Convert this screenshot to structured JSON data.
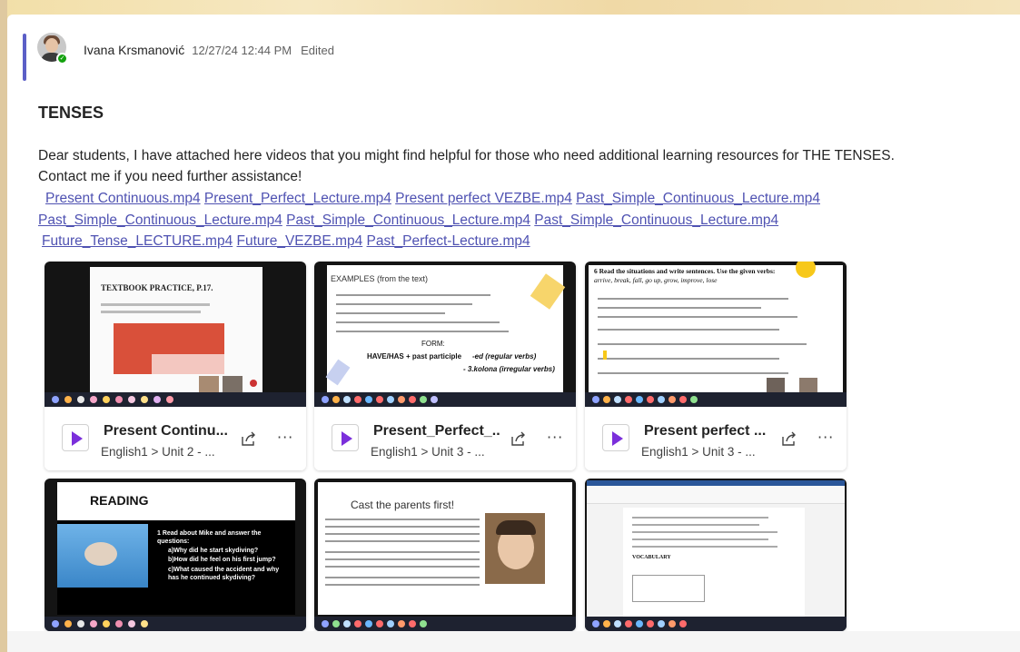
{
  "message": {
    "author": "Ivana Krsmanović",
    "timestamp": "12/27/24 12:44 PM",
    "edited_label": "Edited",
    "subject": "TENSES",
    "body_line1": "Dear students, I have attached here videos that you might find helpful for those who need additional learning resources for THE TENSES.",
    "body_line2": "Contact me if you need further assistance!",
    "links_row1": [
      "Present Continuous.mp4",
      "Present_Perfect_Lecture.mp4",
      "Present perfect VEZBE.mp4",
      "Past_Simple_Continuous_Lecture.mp4"
    ],
    "links_row2": [
      "Past_Simple_Continuous_Lecture.mp4",
      "Past_Simple_Continuous_Lecture.mp4",
      "Past_Simple_Continuous_Lecture.mp4"
    ],
    "links_row3": [
      "Future_Tense_LECTURE.mp4",
      "Future_VEZBE.mp4",
      "Past_Perfect-Lecture.mp4"
    ]
  },
  "tiles": [
    {
      "title": "Present Continu...",
      "path": "English1 > Unit 2 - ...",
      "slide_heading": "TEXTBOOK PRACTICE, P.17."
    },
    {
      "title": "Present_Perfect_...",
      "path": "English1 > Unit 3 - ...",
      "slide_heading": "EXAMPLES (from the text)",
      "slide_form": "FORM:",
      "slide_formula": "HAVE/HAS + past participle",
      "slide_note1": "-ed (regular verbs)",
      "slide_note2": "- 3.kolona (irregular verbs)"
    },
    {
      "title": "Present perfect ...",
      "path": "English1 > Unit 3 - ...",
      "slide_heading": "6 Read the situations and write sentences. Use the given verbs:",
      "slide_verbs": "arrive, break, fall, go up, grow, improve, lose"
    },
    {
      "slide_heading": "READING",
      "slide_q1": "1 Read about Mike and answer the questions:",
      "slide_q2": "a)Why did he start skydiving?",
      "slide_q3": "b)How did he feel on his first jump?",
      "slide_q4": "c)What caused the accident and why has he continued skydiving?"
    },
    {
      "slide_heading": "Cast the parents first!"
    },
    {
      "slide_heading": "VOCABULARY"
    }
  ],
  "colors": {
    "accent": "#5b5fc7",
    "link": "#4f52b2",
    "presence": "#13a10e",
    "play": "#7b2fdb"
  }
}
